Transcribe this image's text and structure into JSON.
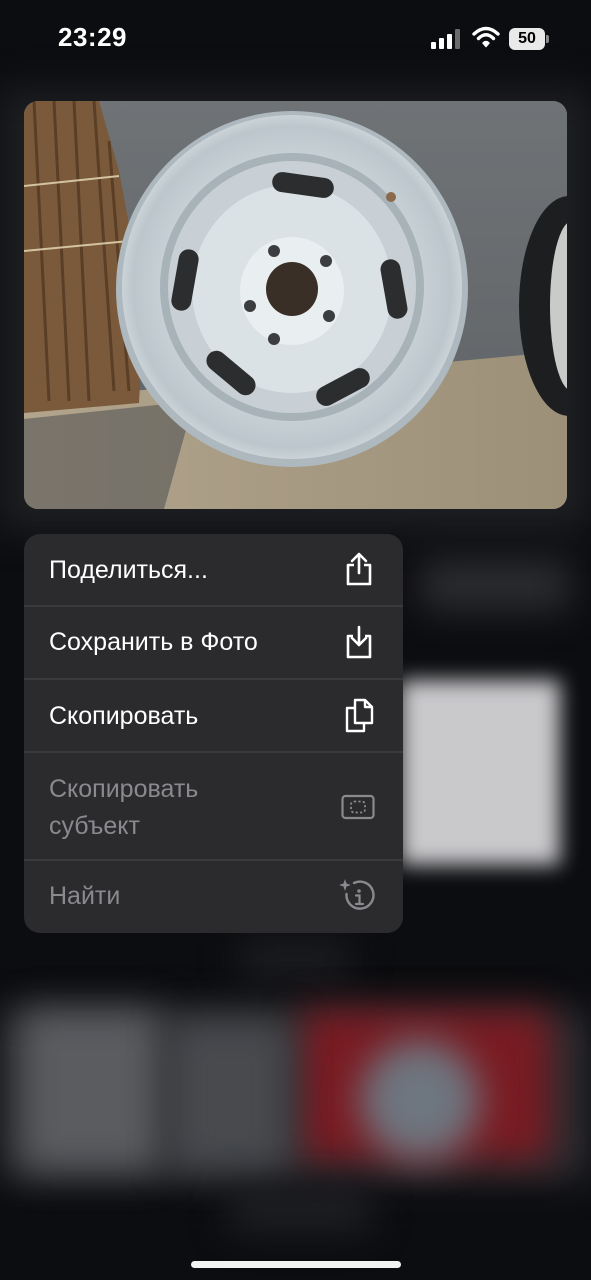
{
  "status_bar": {
    "time": "23:29",
    "battery": "50"
  },
  "photo": {
    "subject": "white steel wheel rim"
  },
  "context_menu": {
    "items": [
      {
        "label": "Поделиться...",
        "icon": "share-icon",
        "enabled": true
      },
      {
        "label": "Сохранить в Фото",
        "icon": "save-to-photos-icon",
        "enabled": true
      },
      {
        "label": "Скопировать",
        "icon": "copy-icon",
        "enabled": true
      },
      {
        "label": "Скопировать\nсубъект",
        "icon": "copy-subject-icon",
        "enabled": false
      },
      {
        "label": "Найти",
        "icon": "visual-lookup-icon",
        "enabled": false
      }
    ]
  },
  "colors": {
    "menu_bg": "#2b2b2e",
    "disabled_text": "#8a8a8e"
  }
}
